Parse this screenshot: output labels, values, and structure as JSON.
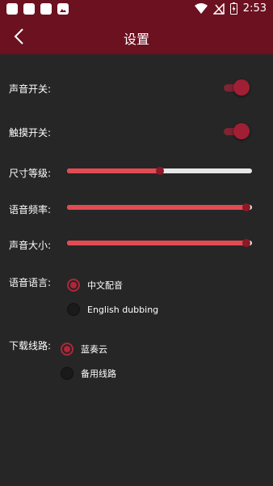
{
  "status_bar": {
    "time": "2:53"
  },
  "header": {
    "title": "设置"
  },
  "settings": {
    "sound_switch": {
      "label": "声音开关:",
      "on": true
    },
    "touch_switch": {
      "label": "触摸开关:",
      "on": true
    },
    "size_level": {
      "label": "尺寸等级:",
      "value": 0.5
    },
    "voice_rate": {
      "label": "语音频率:",
      "value": 0.97
    },
    "volume": {
      "label": "声音大小:",
      "value": 0.97
    },
    "voice_language": {
      "label": "语音语言:",
      "options": [
        "中文配音",
        "English dubbing"
      ],
      "selected": 0
    },
    "download_route": {
      "label": "下载线路:",
      "options": [
        "蓝奏云",
        "备用线路"
      ],
      "selected": 0
    }
  },
  "colors": {
    "bar": "#6b1120",
    "accent": "#e24b52",
    "background": "#262626"
  }
}
